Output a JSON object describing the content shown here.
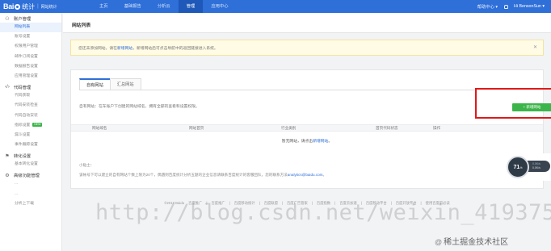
{
  "header": {
    "brand_bai": "Bai",
    "brand_tongji": "统计",
    "site_name": "网站统计",
    "nav": [
      "主页",
      "基础报告",
      "分析云",
      "管理",
      "应用中心"
    ],
    "nav_active_index": 3,
    "help": "帮助中心 ▾",
    "user": "Hi BensonSun ▾",
    "accent": "#2e6fd8"
  },
  "sidebar": {
    "groups": [
      {
        "label": "账户管理",
        "icon": "user-icon",
        "items": [
          "网站列表",
          "账号设置",
          "权限用户管理",
          "邮件订阅设置",
          "数据报告设置",
          "应用管理设置"
        ]
      },
      {
        "label": "代码管理",
        "icon": "code-icon",
        "items": [
          "代码获取",
          "代码安装检查",
          "代码自动安装",
          "指标设置",
          "漏斗设置",
          "事件跟踪设置"
        ]
      },
      {
        "label": "转化设置",
        "icon": "flag-icon",
        "items": [
          "基本转化设置"
        ]
      },
      {
        "label": "高级功能管理",
        "icon": "gear-icon",
        "items": []
      }
    ],
    "trailing_items": [
      "...",
      "...",
      "分析上下载"
    ],
    "new_badge": "NEW"
  },
  "main": {
    "title": "网站列表",
    "notice": {
      "text_before": "您还未添加网站，请在",
      "link": "新增网站",
      "text_after": "，新增网站后可点击导航中的返回链接进入系统。",
      "close": "✕"
    },
    "tabs": [
      "自有网站",
      "汇总网站"
    ],
    "description": "自有网站：在车账户下创建的网站域名，拥有全部的查看和设置权限。",
    "add_button": "+ 新增网站",
    "table_headers": [
      "网站域名",
      "网站首页",
      "行业类别",
      "首页代码状态",
      "操作"
    ],
    "empty_before": "暂无网站，请点击",
    "empty_link": "新增网站",
    "empty_after": "。",
    "tips_title": "小贴士：",
    "tips_before": "该帐号下可以建立的自有网站个数上限为20个，偶遇到百度统计分析五题的企业信息请联系百度统计的客服团队，您的联系方法",
    "tips_link": "analytics@baidu.com",
    "tips_after": "。"
  },
  "widget": {
    "value": "71",
    "unit": "%",
    "line1": "0.0K/s",
    "line2": "0.0K/s"
  },
  "footer": {
    "copyright": "©2018 Baidu",
    "links": [
      "百度推广",
      "百度推广",
      "百度移动统计",
      "百度联盟",
      "百度广告管家",
      "百度指数",
      "百度云加速",
      "百度移动平台",
      "百度开放平台",
      "使用百度前必读"
    ]
  },
  "overlay": {
    "watermark": "http://blog.csdn.net/weixin_41937552",
    "credit": "稀土掘金技术社区"
  }
}
